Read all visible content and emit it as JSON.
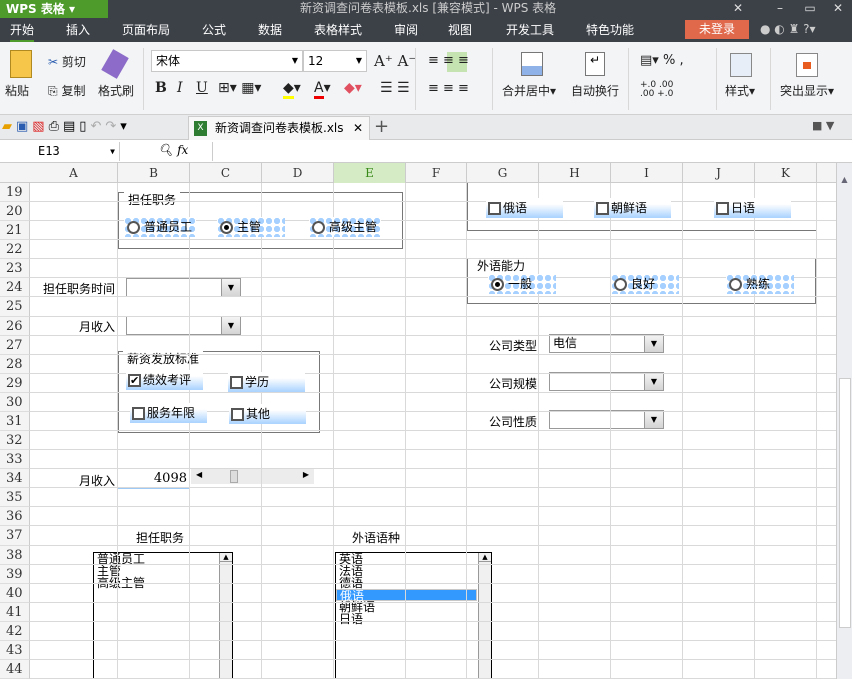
{
  "app": {
    "logo": "WPS 表格",
    "title": "新资调查问卷表模板.xls [兼容模式] - WPS 表格"
  },
  "menu": [
    "开始",
    "插入",
    "页面布局",
    "公式",
    "数据",
    "表格样式",
    "审阅",
    "视图",
    "开发工具",
    "特色功能"
  ],
  "login": "未登录",
  "ribbon": {
    "paste": "粘贴",
    "cut": "剪切",
    "copy": "复制",
    "format_painter": "格式刷",
    "font": "宋体",
    "size": "12",
    "bold": "B",
    "italic": "I",
    "underline": "U",
    "merge": "合并居中",
    "wrap": "自动换行",
    "percent": "%",
    "comma": ",",
    "styles": "样式",
    "highlight": "突出显示"
  },
  "doc_tab": "新资调查问卷表模板.xls",
  "name_box": "E13",
  "fx": "fx",
  "columns": [
    "A",
    "B",
    "C",
    "D",
    "E",
    "F",
    "G",
    "H",
    "I",
    "J",
    "K"
  ],
  "rows": [
    "19",
    "20",
    "21",
    "22",
    "23",
    "24",
    "25",
    "26",
    "27",
    "28",
    "29",
    "30",
    "31",
    "32",
    "33",
    "34",
    "35",
    "36",
    "37",
    "38",
    "39",
    "40",
    "41",
    "42",
    "43",
    "44"
  ],
  "position_group": {
    "title": "担任职务",
    "options": [
      "普通员工",
      "主管",
      "高级主管"
    ],
    "selected": 1
  },
  "lang_checks": [
    {
      "label": "俄语",
      "checked": false
    },
    {
      "label": "朝鲜语",
      "checked": false
    },
    {
      "label": "日语",
      "checked": false
    }
  ],
  "lang_ability": {
    "title": "外语能力",
    "options": [
      "一般",
      "良好",
      "熟练"
    ],
    "selected": 0
  },
  "labels": {
    "position_time": "担任职务时间",
    "monthly_income": "月收入",
    "company_type": "公司类型",
    "company_size": "公司规模",
    "company_nature": "公司性质",
    "monthly_income2": "月收入",
    "list_position": "担任职务",
    "list_lang": "外语语种"
  },
  "combos": {
    "position_time": "",
    "monthly_income": "",
    "company_type": "电信",
    "company_size": "",
    "company_nature": ""
  },
  "salary_group": {
    "title": "薪资发放标准",
    "options": [
      {
        "label": "绩效考评",
        "checked": true
      },
      {
        "label": "学历",
        "checked": false
      },
      {
        "label": "服务年限",
        "checked": false
      },
      {
        "label": "其他",
        "checked": false
      }
    ]
  },
  "income_value": "4098",
  "income_scroll_fraction": 0.28,
  "list_position": [
    "普通员工",
    "主管",
    "高级主管"
  ],
  "list_lang": [
    "英语",
    "法语",
    "德语",
    "俄语",
    "朝鲜语",
    "日语"
  ],
  "list_lang_selected": 3
}
